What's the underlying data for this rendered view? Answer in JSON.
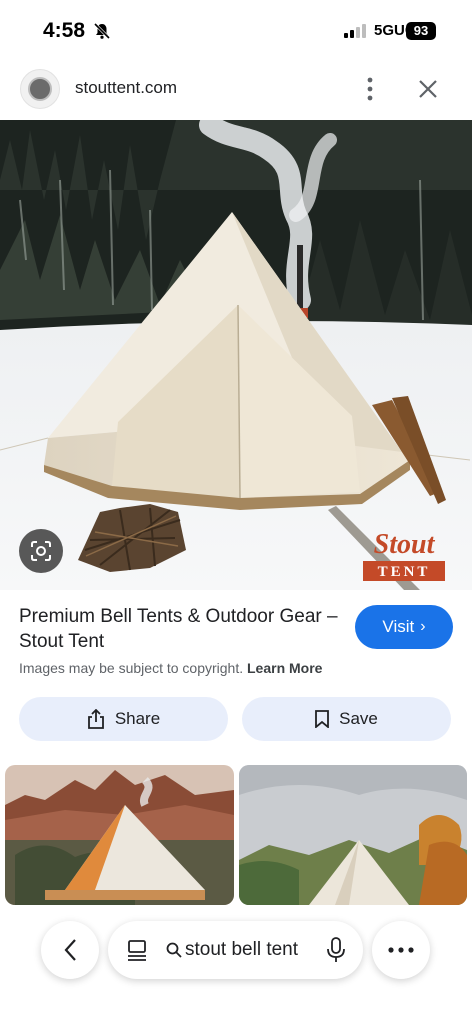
{
  "status": {
    "time": "4:58",
    "network": "5GUC",
    "battery": "93",
    "icons": [
      "bell-off-icon",
      "signal-icon"
    ]
  },
  "header": {
    "domain": "stouttent.com"
  },
  "image": {
    "watermark_top": "Stout",
    "watermark_bottom": "TENT"
  },
  "result": {
    "title": "Premium Bell Tents & Outdoor Gear – Stout Tent",
    "visit_label": "Visit",
    "copyright_text": "Images may be subject to copyright.",
    "learn_more": "Learn More"
  },
  "actions": {
    "share_label": "Share",
    "save_label": "Save"
  },
  "search": {
    "query": "stout bell tent"
  },
  "colors": {
    "accent": "#1a73e8",
    "action_bg": "#e8eefb"
  }
}
